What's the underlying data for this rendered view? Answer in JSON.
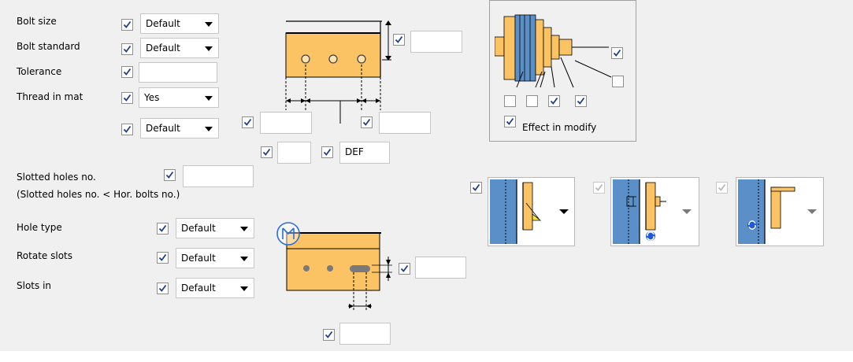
{
  "bolt_fields": {
    "bolt_size_label": "Bolt size",
    "bolt_size_value": "Default",
    "bolt_standard_label": "Bolt standard",
    "bolt_standard_value": "Default",
    "tolerance_label": "Tolerance",
    "tolerance_value": "",
    "thread_in_mat_label": "Thread in mat",
    "thread_in_mat_value": "Yes",
    "extra_select_value": "Default"
  },
  "bolt_dims": {
    "right_edge_value": "",
    "left_spacing_value": "",
    "right_spacing_value": "",
    "small_value": "",
    "def_value": "DEF"
  },
  "effect": {
    "label": "Effect in modify",
    "checkbox_states": [
      false,
      false,
      true,
      true
    ]
  },
  "slots": {
    "slotted_holes_label": "Slotted holes no.",
    "slotted_holes_value": "",
    "slotted_note": "(Slotted holes no. < Hor. bolts no.)",
    "hole_type_label": "Hole type",
    "hole_type_value": "Default",
    "rotate_slots_label": "Rotate slots",
    "rotate_slots_value": "Default",
    "slots_in_label": "Slots in",
    "slots_in_value": "Default",
    "slot_height_value": "",
    "slot_length_value": ""
  },
  "colors": {
    "plate": "#fcc365",
    "beam": "#5b8fc8",
    "check": "#1c3f8c",
    "highlight": "#2a6fd6"
  },
  "icons": [
    "checkbox-check-icon",
    "dropdown-arrow-icon",
    "bolt-plate-icon",
    "bolt-assembly-icon",
    "slotted-plate-icon",
    "weld-option-icon",
    "bolt-side-option-icon",
    "rotate-option-icon",
    "focus-marker-icon"
  ]
}
